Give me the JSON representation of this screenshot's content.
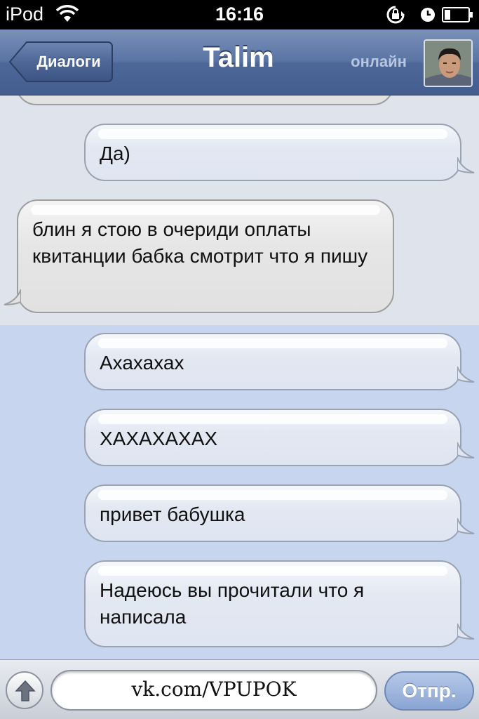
{
  "status_bar": {
    "carrier": "iPod",
    "time": "16:16"
  },
  "nav": {
    "back_label": "Диалоги",
    "title": "Talim",
    "status": "онлайн",
    "avatar_icon": "user-photo-icon"
  },
  "messages": [
    {
      "direction": "out",
      "text": "Да)"
    },
    {
      "direction": "in",
      "text": "блин я стою в очериди оплаты квитанции бабка смотрит что я пишу"
    },
    {
      "direction": "out",
      "text": "Ахахахах"
    },
    {
      "direction": "out",
      "text": "ХАХАХАХАХ"
    },
    {
      "direction": "out",
      "text": "привет бабушка"
    },
    {
      "direction": "out",
      "text": "Надеюсь вы прочитали что я написала"
    }
  ],
  "input_bar": {
    "attach_icon": "arrow-up-icon",
    "input_value": "vk.com/VPUPOK",
    "send_label": "Отпр."
  },
  "colors": {
    "nav_bar": "#4d6798",
    "unread_background": "#c7d5ee",
    "read_background": "#dfe3ec",
    "send_button": "#8aa5d3"
  }
}
